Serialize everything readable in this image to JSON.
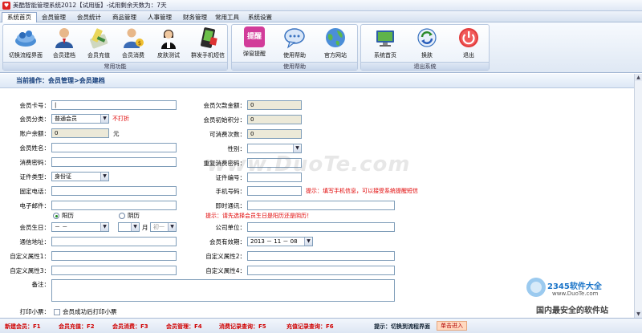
{
  "window": {
    "title": "美酷智能管理系统2012【试用版】-试用剩余天数为：7天"
  },
  "menu": [
    {
      "label": "系统首页",
      "active": true
    },
    {
      "label": "会员管理"
    },
    {
      "label": "会员统计"
    },
    {
      "label": "商品管理"
    },
    {
      "label": "人事管理"
    },
    {
      "label": "财务管理"
    },
    {
      "label": "常用工具"
    },
    {
      "label": "系统设置"
    }
  ],
  "ribbon": {
    "group1": {
      "label": "常用功能",
      "buttons": [
        "切换流程界面",
        "会员建档",
        "会员充值",
        "会员消费",
        "皮肤测试",
        "群发手机短信"
      ]
    },
    "group2": {
      "label": "使用帮助",
      "buttons": [
        "弹窗提醒",
        "使用帮助",
        "官方网站"
      ],
      "popup_icon_text": "提醒"
    },
    "group3": {
      "label": "退出系统",
      "buttons": [
        "系统首页",
        "换肤",
        "退出"
      ]
    }
  },
  "breadcrumb": "当前操作：会员管理>会员建档",
  "form": {
    "member_no": {
      "label": "会员卡号："
    },
    "member_type": {
      "label": "会员分类：",
      "value": "普通会员",
      "note": "不打折"
    },
    "balance": {
      "label": "账户余额：",
      "value": "0",
      "unit": "元"
    },
    "name": {
      "label": "会员姓名："
    },
    "consume_pwd": {
      "label": "消费密码："
    },
    "id_type": {
      "label": "证件类型：",
      "value": "身份证"
    },
    "phone": {
      "label": "固定电话："
    },
    "email": {
      "label": "电子邮件："
    },
    "calendar": {
      "solar": "阳历",
      "lunar": "阴历"
    },
    "birthday": {
      "label": "会员生日：",
      "value": "－ －",
      "lunar_unit": "月",
      "lunar_day": "初一"
    },
    "address": {
      "label": "通信地址："
    },
    "custom1": {
      "label": "自定义属性1："
    },
    "custom3": {
      "label": "自定义属性3："
    },
    "debt": {
      "label": "会员欠款金额：",
      "value": "0"
    },
    "init_points": {
      "label": "会员初始积分：",
      "value": "0"
    },
    "times": {
      "label": "可消费次数：",
      "value": "0"
    },
    "gender": {
      "label": "性别："
    },
    "repeat_pwd": {
      "label": "重复消费密码："
    },
    "id_no": {
      "label": "证件编号："
    },
    "mobile": {
      "label": "手机号码：",
      "hint": "提示：填写手机信息，可以接受系统提醒短信"
    },
    "im": {
      "label": "即时通讯："
    },
    "birthday_hint": "提示：请先选择会员生日是阳历还是阴历！",
    "company": {
      "label": "公司单位："
    },
    "expiry": {
      "label": "会员有效期：",
      "value": "2013 － 11 － 08"
    },
    "custom2": {
      "label": "自定义属性2："
    },
    "custom4": {
      "label": "自定义属性4："
    },
    "remark": {
      "label": "备注："
    },
    "print": {
      "label": "打印小票：",
      "option": "会员成功后打印小票"
    }
  },
  "statusbar": {
    "shortcuts": [
      "新建会员：F1",
      "会员充值：F2",
      "会员消费：F3",
      "会员管理：F4",
      "消费记录查询：F5",
      "充值记录查询：F6"
    ],
    "hint": "提示：切换到流程界面",
    "entry": "单击进入"
  },
  "watermark": {
    "site": "www.DuoTe.com"
  },
  "branding": {
    "logo": "2345软件大全",
    "url": "www.DuoTe.com",
    "slogan": "国内最安全的软件站"
  }
}
